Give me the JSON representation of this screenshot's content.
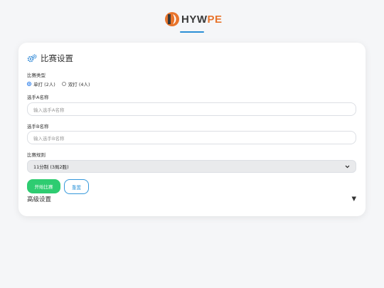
{
  "logo": {
    "text_main": "HYW",
    "text_accent": "PE"
  },
  "card": {
    "title": "比赛设置",
    "match_type": {
      "label": "比赛类型",
      "options": [
        {
          "label": "单打 (2人)",
          "selected": true
        },
        {
          "label": "双打 (4人)",
          "selected": false
        }
      ]
    },
    "player_a": {
      "label": "选手A名称",
      "placeholder": "输入选手A名称"
    },
    "player_b": {
      "label": "选手B名称",
      "placeholder": "输入选手B名称"
    },
    "rules": {
      "label": "比赛规则",
      "selected": "11分制 (3局2胜)"
    },
    "start_button": "开始比赛",
    "reset_button": "重置",
    "advanced": {
      "label": "高级设置",
      "toggle": "▼"
    }
  },
  "colors": {
    "accent_green": "#2ecc71",
    "accent_blue": "#3498db",
    "logo_orange": "#e8742c",
    "underline_blue": "#2a8fd6"
  }
}
